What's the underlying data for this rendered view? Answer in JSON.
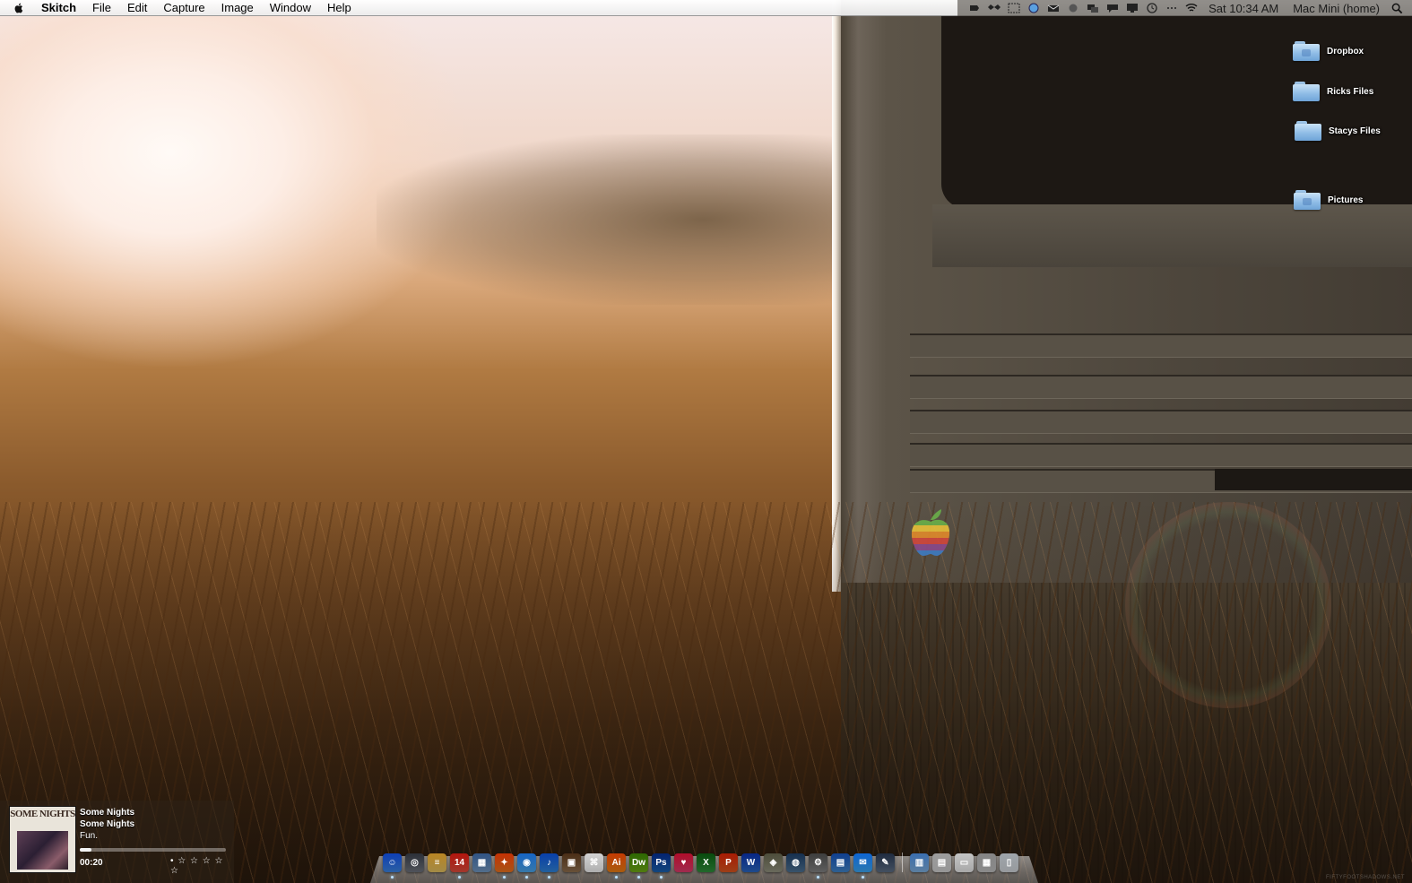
{
  "menubar": {
    "app_name": "Skitch",
    "menus": [
      "File",
      "Edit",
      "Capture",
      "Image",
      "Window",
      "Help"
    ],
    "clock": "Sat 10:34 AM",
    "user": "Mac Mini (home)",
    "status_icons": [
      "evernote-icon",
      "dropbox-like-icon",
      "screen-capture-icon",
      "globe-icon",
      "mail-icon",
      "record-icon",
      "display-icon",
      "chat-icon",
      "monitor-icon",
      "time-machine-icon",
      "bluetooth-icon",
      "wifi-icon"
    ]
  },
  "desktop": {
    "icons": [
      {
        "label": "Dropbox",
        "icon": "folder-icon"
      },
      {
        "label": "Ricks Files",
        "icon": "folder-icon"
      },
      {
        "label": "Stacys Files",
        "icon": "folder-icon"
      },
      {
        "label": "Pictures",
        "icon": "folder-icon"
      }
    ]
  },
  "now_playing": {
    "art_title": "SOME NIGHTS",
    "title": "Some Nights",
    "album": "Some Nights",
    "artist": "Fun.",
    "time": "00:20",
    "progress": 0.08,
    "rating_text": "• ☆ ☆ ☆ ☆ ☆"
  },
  "dock": {
    "apps": [
      {
        "name": "finder",
        "glyph": "☺",
        "color": "#3b7fd8",
        "running": true
      },
      {
        "name": "launchpad",
        "glyph": "◎",
        "color": "#6a6f78",
        "running": false
      },
      {
        "name": "notes",
        "glyph": "≡",
        "color": "#d9b85e",
        "running": false
      },
      {
        "name": "calendar",
        "glyph": "14",
        "color": "#d64a3b",
        "running": true
      },
      {
        "name": "preview",
        "glyph": "▦",
        "color": "#6f92b8",
        "running": false
      },
      {
        "name": "firefox",
        "glyph": "✦",
        "color": "#e0701f",
        "running": true
      },
      {
        "name": "safari",
        "glyph": "◉",
        "color": "#4aa0e0",
        "running": true
      },
      {
        "name": "itunes",
        "glyph": "♪",
        "color": "#2f7fd0",
        "running": true
      },
      {
        "name": "photo-app",
        "glyph": "▣",
        "color": "#8a6c4c",
        "running": false
      },
      {
        "name": "acrobat",
        "glyph": "⌘",
        "color": "#e8e8e8",
        "running": false
      },
      {
        "name": "illustrator",
        "glyph": "Ai",
        "color": "#e07a14",
        "running": true
      },
      {
        "name": "dreamweaver",
        "glyph": "Dw",
        "color": "#6ba315",
        "running": true
      },
      {
        "name": "photoshop",
        "glyph": "Ps",
        "color": "#1a5ea8",
        "running": true
      },
      {
        "name": "heart-app",
        "glyph": "♥",
        "color": "#d43a68",
        "running": false
      },
      {
        "name": "excel",
        "glyph": "X",
        "color": "#2e8a3a",
        "running": false
      },
      {
        "name": "powerpoint",
        "glyph": "P",
        "color": "#d0531f",
        "running": false
      },
      {
        "name": "word",
        "glyph": "W",
        "color": "#2a63b8",
        "running": false
      },
      {
        "name": "archive-utility",
        "glyph": "◈",
        "color": "#8c8c7a",
        "running": false
      },
      {
        "name": "network-app",
        "glyph": "◍",
        "color": "#4b6e8e",
        "running": false
      },
      {
        "name": "system-preferences",
        "glyph": "⚙",
        "color": "#7d7d7d",
        "running": true
      },
      {
        "name": "remote-desktop",
        "glyph": "▤",
        "color": "#3f7fc0",
        "running": false
      },
      {
        "name": "messages",
        "glyph": "✉",
        "color": "#3aa0e8",
        "running": true
      },
      {
        "name": "tools-app",
        "glyph": "✎",
        "color": "#5a6a80",
        "running": false
      }
    ],
    "stacks": [
      {
        "name": "applications-stack",
        "glyph": "▥",
        "color": "#7aa8d4"
      },
      {
        "name": "documents-stack",
        "glyph": "▤",
        "color": "#c8c8c8"
      },
      {
        "name": "screenshots-stack",
        "glyph": "▭",
        "color": "#e0e0e0"
      },
      {
        "name": "downloads-stack",
        "glyph": "▦",
        "color": "#b8b8b8"
      },
      {
        "name": "trash",
        "glyph": "▯",
        "color": "#c9cdd1"
      }
    ]
  }
}
